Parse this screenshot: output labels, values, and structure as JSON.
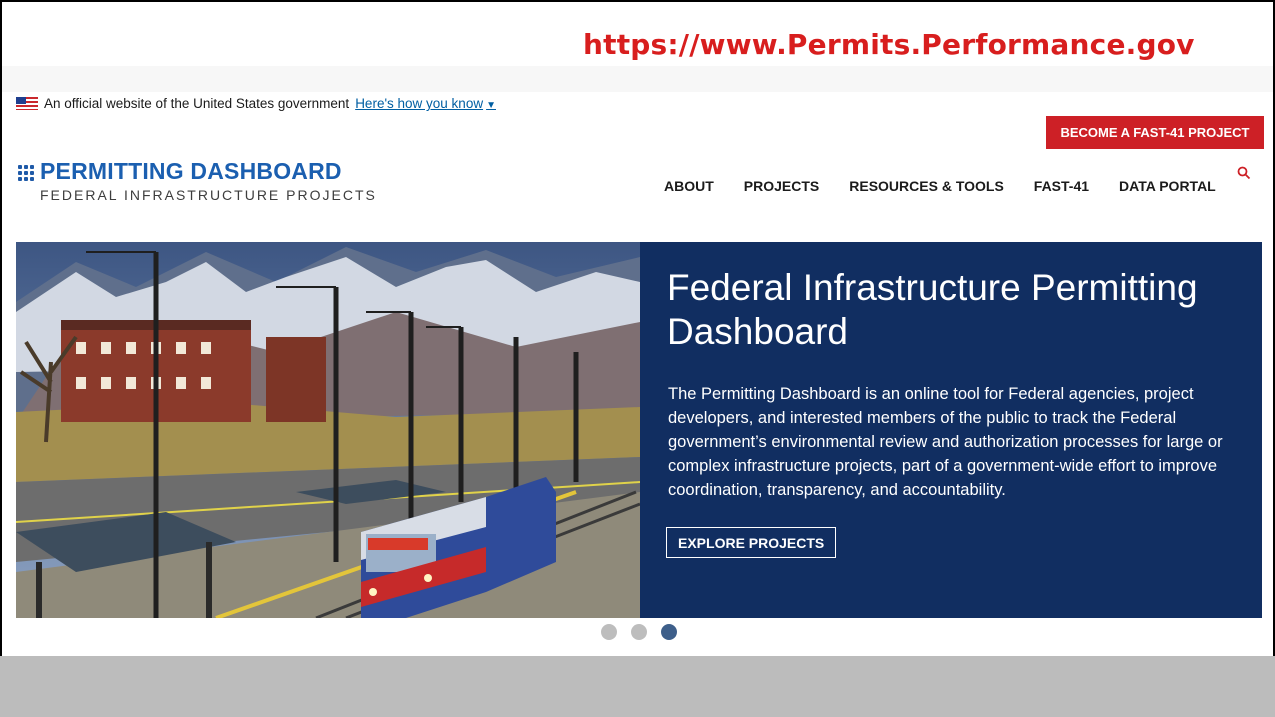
{
  "slide": {
    "url_caption": "https://www.Permits.Performance.gov"
  },
  "gov_banner": {
    "text": "An official website of the United States government",
    "link": "Here's how you know"
  },
  "header": {
    "cta_label": "BECOME A FAST-41 PROJECT",
    "logo_title": "PERMITTING DASHBOARD",
    "logo_subtitle": "FEDERAL INFRASTRUCTURE PROJECTS",
    "nav": [
      {
        "label": "ABOUT"
      },
      {
        "label": "PROJECTS"
      },
      {
        "label": "RESOURCES & TOOLS"
      },
      {
        "label": "FAST-41"
      },
      {
        "label": "DATA PORTAL"
      }
    ]
  },
  "hero": {
    "title": "Federal Infrastructure Permitting Dashboard",
    "description": "The Permitting Dashboard is an online tool for Federal agencies, project developers, and interested members of the public to track the Federal government’s environmental review and authorization processes for large or complex infrastructure projects, part of a government-wide effort to improve coordination, transparency, and accountability.",
    "button_label": "EXPLORE PROJECTS"
  },
  "carousel": {
    "slides": 3,
    "active": 3
  },
  "colors": {
    "caption_red": "#d81e1e",
    "cta_red": "#cd2026",
    "logo_blue": "#1b5fb0",
    "hero_navy": "#112e61",
    "link_blue": "#005ea2"
  }
}
